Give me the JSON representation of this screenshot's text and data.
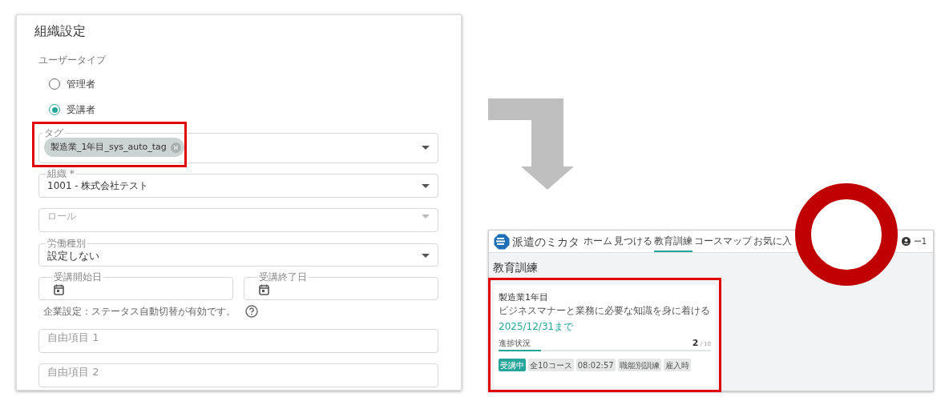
{
  "settings_form": {
    "title": "組織設定",
    "user_type": {
      "label": "ユーザータイプ",
      "options": [
        {
          "label": "管理者",
          "selected": false
        },
        {
          "label": "受講者",
          "selected": true
        }
      ]
    },
    "tag_field": {
      "label": "タグ",
      "chips": [
        "製造業_1年目_sys_auto_tag"
      ]
    },
    "organization_field": {
      "label": "組織 *",
      "value": "1001 - 株式会社テスト"
    },
    "role_field": {
      "placeholder": "ロール"
    },
    "work_type_field": {
      "label": "労働種別",
      "value": "設定しない"
    },
    "date_fields": [
      {
        "label": "受講開始日"
      },
      {
        "label": "受講終了日"
      }
    ],
    "note": "企業設定：ステータス自動切替が有効です。",
    "free_fields": [
      {
        "placeholder": "自由項目 1"
      },
      {
        "placeholder": "自由項目 2"
      }
    ]
  },
  "learner_screen": {
    "logo": "派遣のミカタ",
    "nav": [
      {
        "label": "ホーム",
        "selected": false
      },
      {
        "label": "見つける",
        "selected": false
      },
      {
        "label": "教育訓練",
        "selected": true
      },
      {
        "label": "コースマップ",
        "selected": false
      },
      {
        "label": "お気に入",
        "selected": false
      }
    ],
    "user": "ー1",
    "page_title": "教育訓練",
    "course_card": {
      "title": "製造業1年目",
      "description": "ビジネスマナーと業務に必要な知識を身に着ける",
      "deadline": "2025/12/31まで",
      "progress_label": "進捗状況",
      "progress_done": "2",
      "progress_total": "/ 10",
      "level": 0.2,
      "tags": [
        {
          "label": "受講中",
          "kind": "status"
        },
        {
          "label": "全10コース",
          "kind": "plain"
        },
        {
          "label": "08:02:57",
          "kind": "plain"
        },
        {
          "label": "職能別訓練",
          "kind": "plain"
        },
        {
          "label": "雇入時",
          "kind": "plain"
        }
      ]
    }
  }
}
